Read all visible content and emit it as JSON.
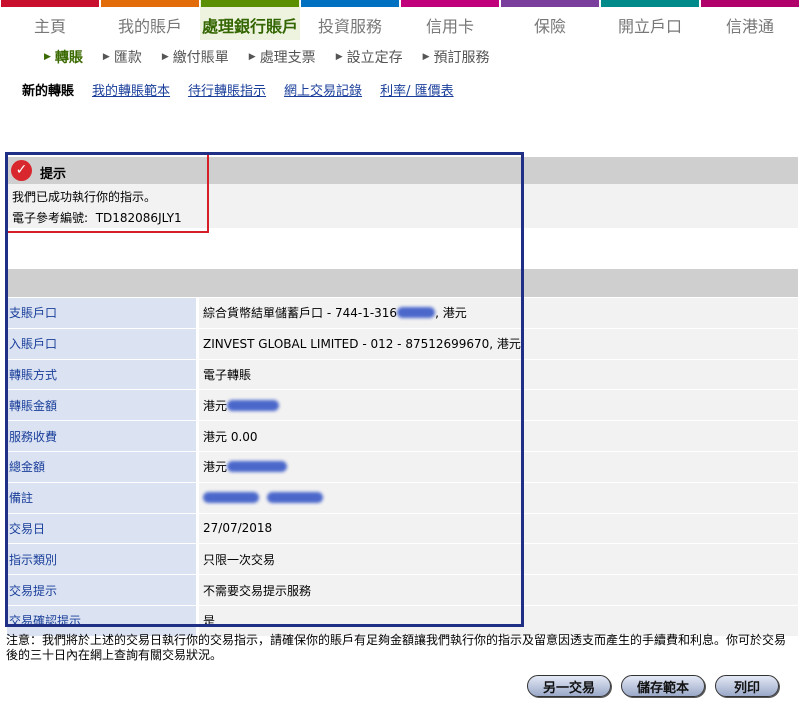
{
  "top_nav": [
    {
      "label": "主頁",
      "color": "#c8102e"
    },
    {
      "label": "我的賬戶",
      "color": "#e26b0a"
    },
    {
      "label": "處理銀行賬戶",
      "color": "#5a8f00"
    },
    {
      "label": "投資服務",
      "color": "#0070c0"
    },
    {
      "label": "信用卡",
      "color": "#c0007a"
    },
    {
      "label": "保險",
      "color": "#7a3e9d"
    },
    {
      "label": "開立戶口",
      "color": "#008a8a"
    },
    {
      "label": "信港通",
      "color": "#b0006a"
    }
  ],
  "sub_nav": [
    "轉賬",
    "匯款",
    "繳付賬單",
    "處理支票",
    "設立定存",
    "預訂服務"
  ],
  "link_row": [
    "新的轉賬",
    "我的轉賬範本",
    "待行轉賬指示",
    "網上交易記錄",
    "利率/ 匯價表"
  ],
  "notice": {
    "title": "提示",
    "line1": "我們已成功執行你的指示。",
    "line2_label": "電子參考編號:",
    "line2_value": "TD182086JLY1"
  },
  "details": {
    "rows": [
      {
        "label": "支賬戶口",
        "value": "綜合貨幣結單儲蓄戶口 - 744-1-316",
        "suffix": ", 港元"
      },
      {
        "label": "入賬戶口",
        "value": "ZINVEST GLOBAL LIMITED - 012 - 87512699670, 港元"
      },
      {
        "label": "轉賬方式",
        "value": "電子轉賬"
      },
      {
        "label": "轉賬金額",
        "value": "港元"
      },
      {
        "label": "服務收費",
        "value": "港元  0.00"
      },
      {
        "label": "總金額",
        "value": "港元"
      },
      {
        "label": "備註",
        "value": ""
      },
      {
        "label": "交易日",
        "value": "27/07/2018"
      },
      {
        "label": "指示類別",
        "value": "只限一次交易"
      },
      {
        "label": "交易提示",
        "value": "不需要交易提示服務"
      },
      {
        "label": "交易確認提示",
        "value": "是"
      }
    ]
  },
  "footer_note": "注意：我們將於上述的交易日執行你的交易指示，請確保你的賬戶有足夠金額讓我們執行你的指示及留意因透支而產生的手續費和利息。你可於交易後的三十日內在網上查詢有關交易狀況。",
  "buttons": {
    "another": "另一交易",
    "save_template": "儲存範本",
    "print": "列印"
  },
  "colors": {
    "link": "#1a3f9a",
    "label_bg": "#dbe3f3",
    "highlight_red": "#d41f26",
    "highlight_blue": "#1f2f86"
  }
}
